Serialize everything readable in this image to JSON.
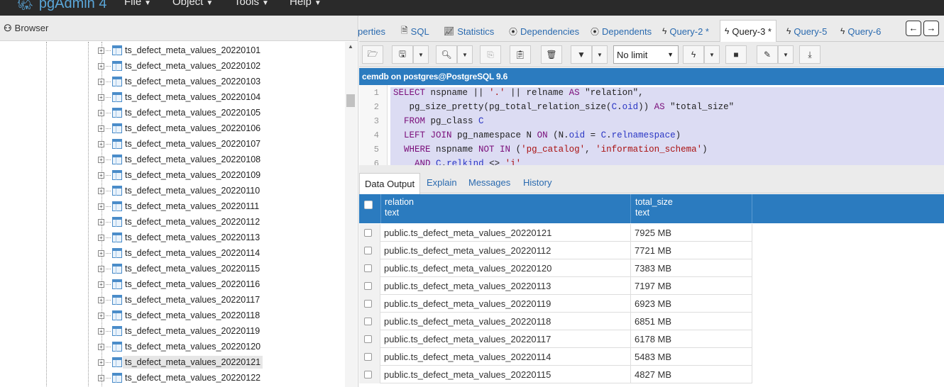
{
  "app": {
    "title": "pgAdmin 4",
    "menus": [
      "File",
      "Object",
      "Tools",
      "Help"
    ]
  },
  "browser": {
    "title": "Browser",
    "items": [
      "ts_defect_meta_values_20220101",
      "ts_defect_meta_values_20220102",
      "ts_defect_meta_values_20220103",
      "ts_defect_meta_values_20220104",
      "ts_defect_meta_values_20220105",
      "ts_defect_meta_values_20220106",
      "ts_defect_meta_values_20220107",
      "ts_defect_meta_values_20220108",
      "ts_defect_meta_values_20220109",
      "ts_defect_meta_values_20220110",
      "ts_defect_meta_values_20220111",
      "ts_defect_meta_values_20220112",
      "ts_defect_meta_values_20220113",
      "ts_defect_meta_values_20220114",
      "ts_defect_meta_values_20220115",
      "ts_defect_meta_values_20220116",
      "ts_defect_meta_values_20220117",
      "ts_defect_meta_values_20220118",
      "ts_defect_meta_values_20220119",
      "ts_defect_meta_values_20220120",
      "ts_defect_meta_values_20220121",
      "ts_defect_meta_values_20220122"
    ],
    "selected_index": 20
  },
  "tabs": {
    "properties": "perties",
    "sql": "SQL",
    "statistics": "Statistics",
    "dependencies": "Dependencies",
    "dependents": "Dependents",
    "query2": "Query-2 *",
    "query3": "Query-3 *",
    "query5": "Query-5",
    "query6": "Query-6"
  },
  "toolbar": {
    "limit": "No limit"
  },
  "connection": "cemdb on postgres@PostgreSQL 9.6",
  "editor": {
    "line_numbers": [
      "1",
      "2",
      "3",
      "4",
      "5",
      "6"
    ]
  },
  "result_tabs": {
    "data_output": "Data Output",
    "explain": "Explain",
    "messages": "Messages",
    "history": "History"
  },
  "grid": {
    "columns": [
      {
        "name": "relation",
        "type": "text"
      },
      {
        "name": "total_size",
        "type": "text"
      }
    ],
    "rows": [
      [
        "public.ts_defect_meta_values_20220121",
        "7925 MB"
      ],
      [
        "public.ts_defect_meta_values_20220112",
        "7721 MB"
      ],
      [
        "public.ts_defect_meta_values_20220120",
        "7383 MB"
      ],
      [
        "public.ts_defect_meta_values_20220113",
        "7197 MB"
      ],
      [
        "public.ts_defect_meta_values_20220119",
        "6923 MB"
      ],
      [
        "public.ts_defect_meta_values_20220118",
        "6851 MB"
      ],
      [
        "public.ts_defect_meta_values_20220117",
        "6178 MB"
      ],
      [
        "public.ts_defect_meta_values_20220114",
        "5483 MB"
      ],
      [
        "public.ts_defect_meta_values_20220115",
        "4827 MB"
      ]
    ]
  },
  "colors": {
    "accent": "#2b7bbf",
    "topbar": "#2a2a2a",
    "editor_highlight": "#dcdcf3"
  }
}
